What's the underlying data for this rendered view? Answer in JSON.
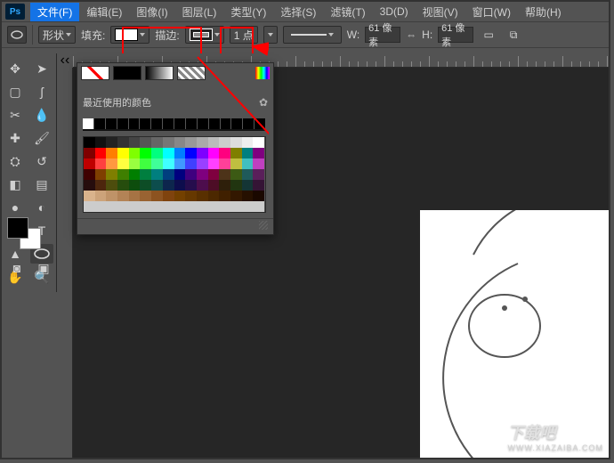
{
  "logo": "Ps",
  "menu": {
    "file": "文件(F)",
    "edit": "编辑(E)",
    "image": "图像(I)",
    "layer": "图层(L)",
    "type": "类型(Y)",
    "select": "选择(S)",
    "filter": "滤镜(T)",
    "threeD": "3D(D)",
    "view": "视图(V)",
    "window": "窗口(W)",
    "help": "帮助(H)"
  },
  "options": {
    "shape_mode": "形状",
    "fill_label": "填充:",
    "stroke_label": "描边:",
    "stroke_width": "1 点",
    "w_label": "W:",
    "w_value": "61 像素",
    "h_label": "H:",
    "h_value": "61 像素"
  },
  "color_panel": {
    "recent_label": "最近使用的颜色"
  },
  "swatch_colors": [
    "#000000",
    "#111111",
    "#222222",
    "#333333",
    "#444444",
    "#555555",
    "#666666",
    "#777777",
    "#888888",
    "#999999",
    "#aaaaaa",
    "#bbbbbb",
    "#cccccc",
    "#dddddd",
    "#eeeeee",
    "#ffffff",
    "#7f0000",
    "#ff0000",
    "#ff7f00",
    "#ffff00",
    "#7fff00",
    "#00ff00",
    "#00ff7f",
    "#00ffff",
    "#007fff",
    "#0000ff",
    "#7f00ff",
    "#ff00ff",
    "#ff007f",
    "#7f7f00",
    "#007f7f",
    "#7f007f",
    "#bf0000",
    "#ff4040",
    "#ff9940",
    "#ffff40",
    "#99ff40",
    "#40ff40",
    "#40ff99",
    "#40ffff",
    "#4099ff",
    "#4040ff",
    "#9940ff",
    "#ff40ff",
    "#ff4099",
    "#bfbf40",
    "#40bfbf",
    "#bf40bf",
    "#3f0000",
    "#7f3f00",
    "#7f7f00",
    "#3f7f00",
    "#007f00",
    "#007f3f",
    "#007f7f",
    "#003f7f",
    "#00007f",
    "#3f007f",
    "#7f007f",
    "#7f003f",
    "#4d3319",
    "#3c5a14",
    "#1f5a5a",
    "#5a1f5a",
    "#260d0d",
    "#4d260d",
    "#4d4d0d",
    "#264d0d",
    "#0d4d0d",
    "#0d4d26",
    "#0d4d4d",
    "#0d264d",
    "#0d0d4d",
    "#260d4d",
    "#4d0d4d",
    "#4d0d26",
    "#2e1f0a",
    "#213510",
    "#143535",
    "#351435",
    "#d9b38c",
    "#cca37a",
    "#bf9368",
    "#b38356",
    "#a67344",
    "#996332",
    "#8c5320",
    "#7f430e",
    "#734000",
    "#663800",
    "#593000",
    "#4c2800",
    "#402000",
    "#331800",
    "#261000",
    "#1a0800",
    "#cccccc",
    "#cccccc",
    "#cccccc",
    "#cccccc",
    "#cccccc",
    "#cccccc",
    "#cccccc",
    "#cccccc",
    "#cccccc",
    "#cccccc",
    "#cccccc",
    "#cccccc",
    "#cccccc",
    "#cccccc",
    "#cccccc",
    "#cccccc"
  ],
  "watermark": {
    "big": "下载吧",
    "small": "WWW.XIAZAIBA.COM"
  }
}
